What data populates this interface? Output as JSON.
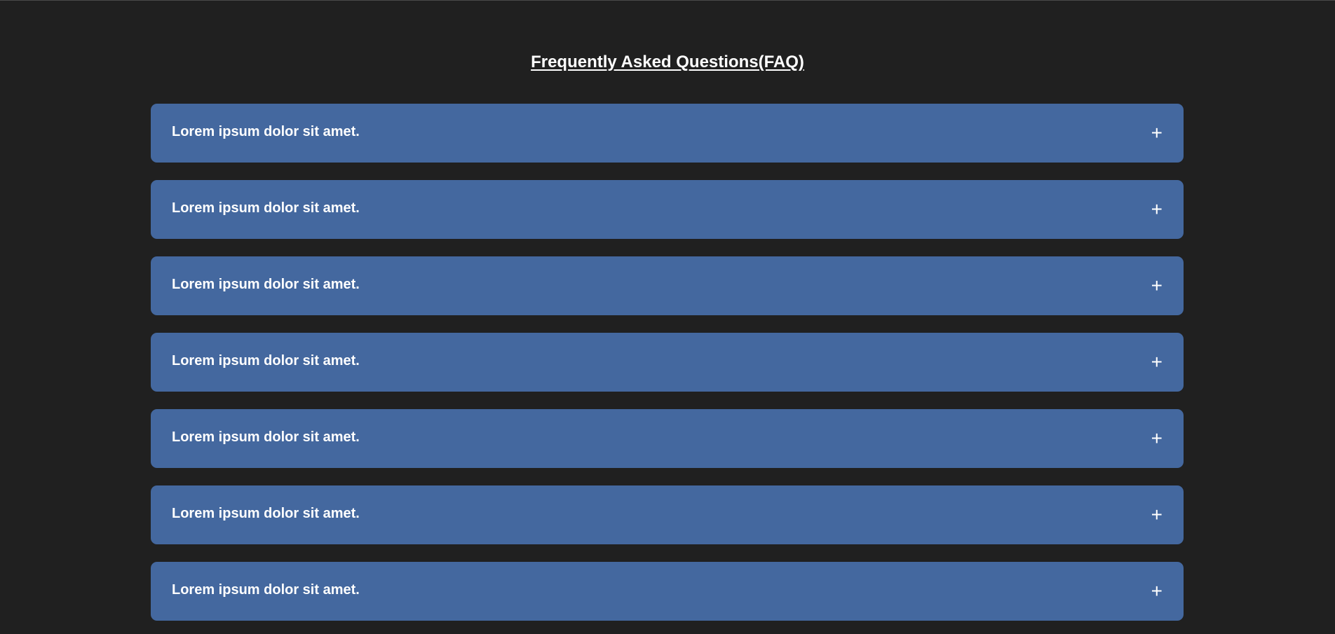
{
  "page": {
    "title": "Frequently Asked Questions(FAQ)"
  },
  "faq": {
    "items": [
      {
        "question": "Lorem ipsum dolor sit amet.",
        "toggle": "+"
      },
      {
        "question": "Lorem ipsum dolor sit amet.",
        "toggle": "+"
      },
      {
        "question": "Lorem ipsum dolor sit amet.",
        "toggle": "+"
      },
      {
        "question": "Lorem ipsum dolor sit amet.",
        "toggle": "+"
      },
      {
        "question": "Lorem ipsum dolor sit amet.",
        "toggle": "+"
      },
      {
        "question": "Lorem ipsum dolor sit amet.",
        "toggle": "+"
      },
      {
        "question": "Lorem ipsum dolor sit amet.",
        "toggle": "+"
      }
    ]
  },
  "colors": {
    "background": "#202020",
    "accordion": "#44689f",
    "text": "#ffffff"
  }
}
